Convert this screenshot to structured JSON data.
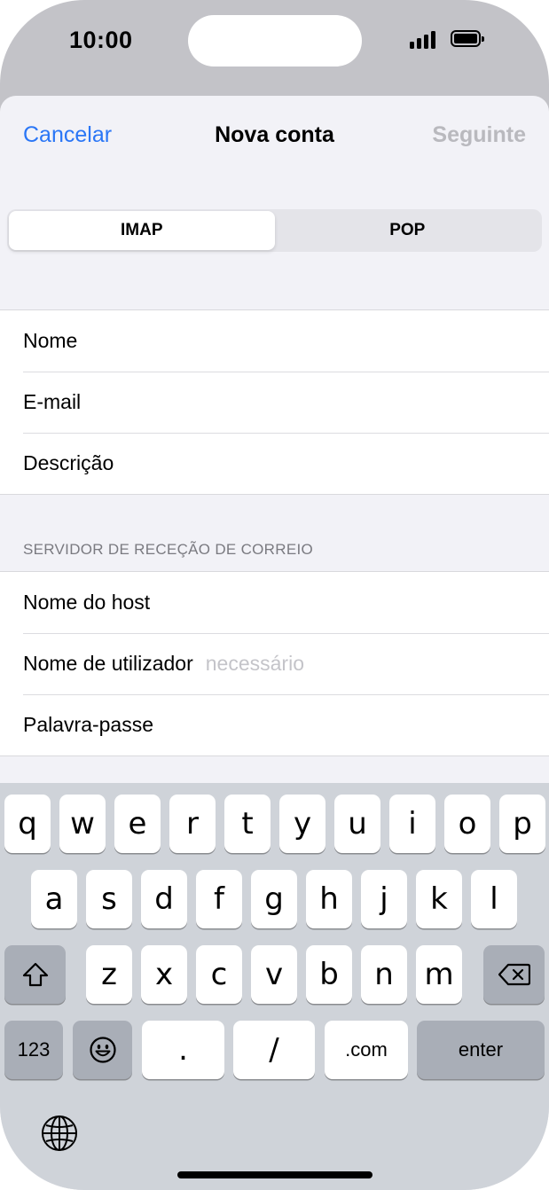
{
  "status_bar": {
    "time": "10:00"
  },
  "nav": {
    "cancel": "Cancelar",
    "title": "Nova conta",
    "next": "Seguinte"
  },
  "segmented": {
    "options": [
      "IMAP",
      "POP"
    ],
    "selected": "IMAP"
  },
  "account_fields": [
    {
      "label": "Nome"
    },
    {
      "label": "E-mail"
    },
    {
      "label": "Descrição"
    }
  ],
  "incoming_server": {
    "header": "SERVIDOR DE RECEÇÃO DE CORREIO",
    "fields": [
      {
        "label": "Nome do host",
        "placeholder": ""
      },
      {
        "label": "Nome de utilizador",
        "placeholder": "necessário"
      },
      {
        "label": "Palavra-passe",
        "placeholder": ""
      }
    ]
  },
  "keyboard": {
    "row1": [
      "q",
      "w",
      "e",
      "r",
      "t",
      "y",
      "u",
      "i",
      "o",
      "p"
    ],
    "row2": [
      "a",
      "s",
      "d",
      "f",
      "g",
      "h",
      "j",
      "k",
      "l"
    ],
    "row3": [
      "z",
      "x",
      "c",
      "v",
      "b",
      "n",
      "m"
    ],
    "numbers_key": "123",
    "period_key": ".",
    "slash_key": "/",
    "dotcom_key": ".com",
    "enter_key": "enter"
  },
  "icons": [
    "signal-icon",
    "battery-icon",
    "shift-icon",
    "backspace-icon",
    "emoji-icon",
    "globe-icon"
  ]
}
